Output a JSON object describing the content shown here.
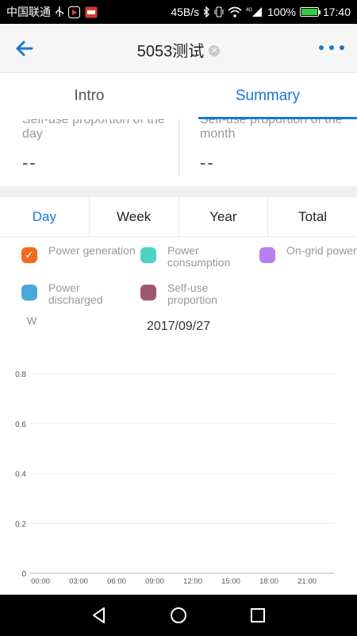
{
  "status_bar": {
    "carrier": "中国联通",
    "net_speed": "45B/s",
    "network_type": "4G",
    "battery": "100%",
    "time": "17:40"
  },
  "header": {
    "title": "5053测试",
    "clear_icon": "clear-circle-icon",
    "back_icon": "arrow-left-icon",
    "more_icon": "more-dots-icon"
  },
  "tabs": [
    {
      "label": "Intro",
      "active": false
    },
    {
      "label": "Summary",
      "active": true
    }
  ],
  "proportions": {
    "day_label": "Self-use proportion of the day",
    "day_value": "--",
    "month_label": "Self-use proportion of the month",
    "month_value": "--"
  },
  "periods": [
    {
      "label": "Day",
      "active": true
    },
    {
      "label": "Week",
      "active": false
    },
    {
      "label": "Year",
      "active": false
    },
    {
      "label": "Total",
      "active": false
    }
  ],
  "legend": [
    {
      "label": "Power generation",
      "color": "#f26b1d",
      "checked": true
    },
    {
      "label": "Power consumption",
      "color": "#4fd1c5",
      "checked": false
    },
    {
      "label": "On-grid power",
      "color": "#b77ef0",
      "checked": false
    },
    {
      "label": "Power discharged",
      "color": "#4aa8d8",
      "checked": false
    },
    {
      "label": "Self-use proportion",
      "color": "#a0566e",
      "checked": false
    }
  ],
  "chart_unit": "W",
  "chart_date": "2017/09/27",
  "chart_data": {
    "type": "line",
    "x_tick_labels": [
      "00:00",
      "03:00",
      "06:00",
      "09:00",
      "12:00",
      "15:00",
      "18:00",
      "21:00"
    ],
    "y_tick_labels": [
      "0",
      "0.2",
      "0.4",
      "0.6",
      "0.8"
    ],
    "ylim": [
      0,
      0.8
    ],
    "ylabel": "W",
    "series": [],
    "grid": true
  },
  "nav": {
    "back_icon": "triangle-back-icon",
    "home_icon": "circle-home-icon",
    "recents_icon": "square-recents-icon"
  }
}
